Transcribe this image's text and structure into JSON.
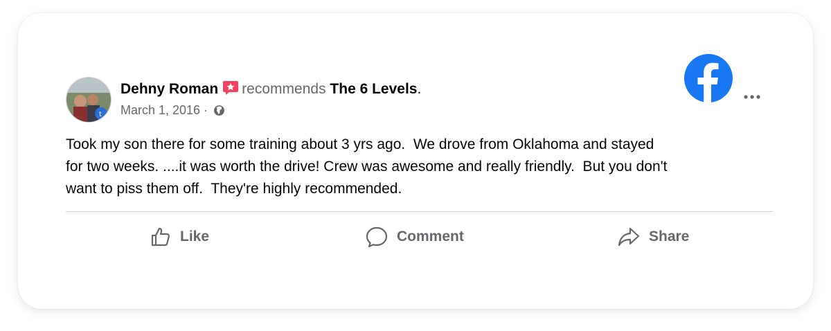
{
  "post": {
    "author": "Dehny Roman",
    "recommends_text": "recommends",
    "page_name": "The 6 Levels",
    "page_suffix": ".",
    "date": "March 1, 2016",
    "date_separator": " · ",
    "privacy_icon": "globe-icon",
    "body": "Took my son there for some training about 3 yrs ago.  We drove from Oklahoma and stayed\nfor two weeks. ....it was worth the drive! Crew was awesome and really friendly.  But you don't\nwant to piss them off.  They're highly recommended."
  },
  "actions": {
    "like_label": "Like",
    "comment_label": "Comment",
    "share_label": "Share"
  },
  "colors": {
    "facebook_blue": "#1877f2",
    "recommend_badge": "#f3425f",
    "secondary_text": "#65676b",
    "primary_text": "#050505",
    "divider": "#ced0d4"
  },
  "icons": {
    "brand": "facebook-logo-icon",
    "more": "more-options-icon",
    "recommend": "recommend-star-icon"
  }
}
